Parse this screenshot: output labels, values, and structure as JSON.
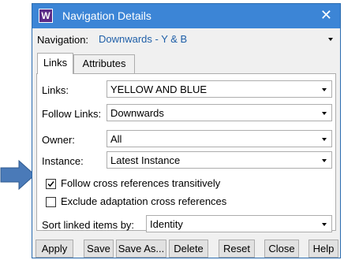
{
  "window": {
    "title": "Navigation Details",
    "app_icon_letter": "W",
    "close_glyph": "✕"
  },
  "navigation": {
    "label": "Navigation:",
    "value": "Downwards - Y & B"
  },
  "tabs": [
    {
      "label": "Links",
      "active": true
    },
    {
      "label": "Attributes",
      "active": false
    }
  ],
  "links_tab": {
    "links": {
      "label": "Links:",
      "value": "YELLOW AND BLUE"
    },
    "follow_links": {
      "label": "Follow Links:",
      "value": "Downwards"
    },
    "owner": {
      "label": "Owner:",
      "value": "All"
    },
    "instance": {
      "label": "Instance:",
      "value": "Latest Instance"
    },
    "follow_cross_refs": {
      "label": "Follow cross references transitively",
      "checked": true
    },
    "exclude_adaptation": {
      "label": "Exclude adaptation cross references",
      "checked": false
    },
    "sort_by": {
      "label": "Sort linked items by:",
      "value": "Identity"
    }
  },
  "buttons": {
    "apply": "Apply",
    "save": "Save",
    "save_as": "Save As...",
    "delete": "Delete",
    "reset": "Reset",
    "close": "Close",
    "help": "Help"
  },
  "colors": {
    "titlebar": "#3c85d6",
    "annotation_arrow": "#4a7ab8",
    "navigation_value_text": "#1f5fa8"
  }
}
